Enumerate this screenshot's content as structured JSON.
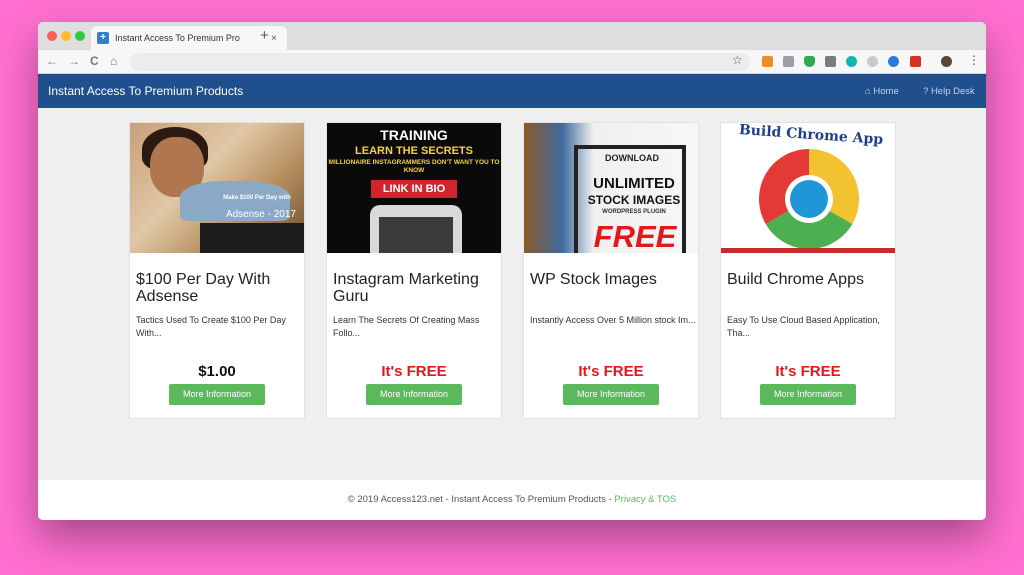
{
  "browser": {
    "tab_title": "Instant Access To Premium Pro",
    "tab_close": "×",
    "new_tab": "+",
    "nav_back": "←",
    "nav_forward": "→",
    "nav_reload": "C",
    "nav_home": "⌂",
    "bookmark_star": "☆",
    "menu": "⋮"
  },
  "navbar": {
    "brand": "Instant Access To Premium Products",
    "links": [
      {
        "icon": "home-icon",
        "label": "Home"
      },
      {
        "icon": "question-icon",
        "label": "Help Desk"
      }
    ]
  },
  "products": [
    {
      "title": "$100 Per Day With Adsense",
      "description": "Tactics Used To Create $100 Per Day With...",
      "price": "$1.00",
      "button": "More Information",
      "image_text": {
        "small": "Make $100 Per Day with",
        "big": "Adsense - 2017"
      }
    },
    {
      "title": "Instagram Marketing Guru",
      "description": "Learn The Secrets Of Creating Mass Follo...",
      "price": "It's FREE",
      "button": "More Information",
      "image_text": {
        "l1": "TRAINING",
        "l2": "LEARN THE SECRETS",
        "l3": "MILLIONAIRE INSTAGRAMMERS DON'T WANT YOU TO KNOW",
        "box": "LINK IN BIO"
      }
    },
    {
      "title": "WP Stock Images",
      "description": "Instantly Access Over 5 Million stock Im...",
      "price": "It's FREE",
      "button": "More Information",
      "image_text": {
        "dl": "DOWNLOAD",
        "unl": "UNLIMITED",
        "si": "STOCK IMAGES",
        "wp": "WORDPRESS PLUGIN",
        "free": "FREE"
      }
    },
    {
      "title": "Build Chrome Apps",
      "description": "Easy To Use Cloud Based Application, Tha...",
      "price": "It's FREE",
      "button": "More Information",
      "image_text": {
        "title": "Build Chrome App"
      }
    }
  ],
  "footer": {
    "text": "© 2019 Access123.net - Instant Access To Premium Products - ",
    "link": "Privacy & TOS"
  },
  "colors": {
    "navbar": "#1f4f8c",
    "button": "#5cb85c",
    "free_price": "#e5171b",
    "page_background": "#ff6fcf"
  }
}
